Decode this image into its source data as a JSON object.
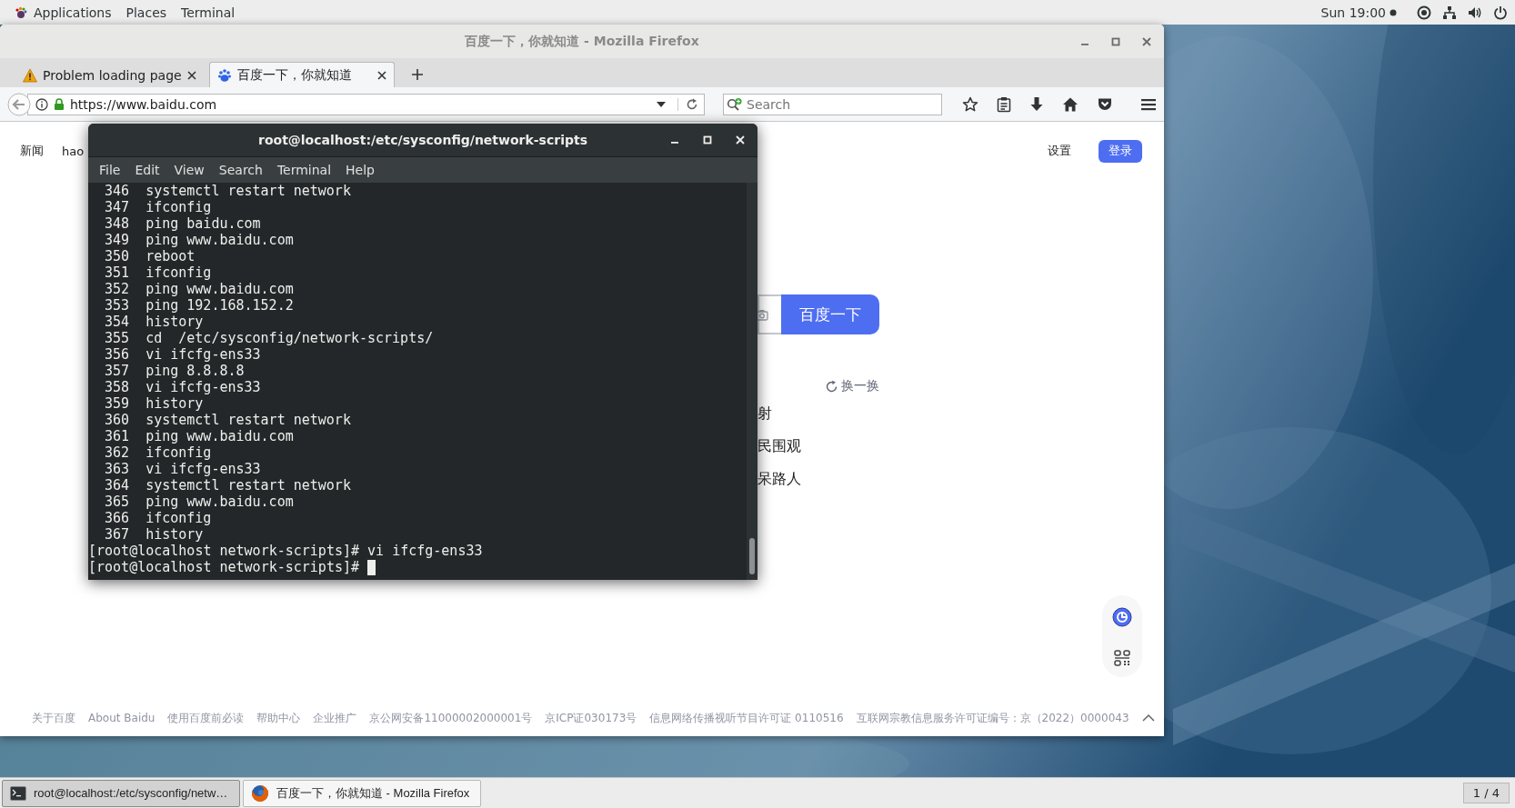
{
  "top_bar": {
    "applications": "Applications",
    "menus": [
      "Places",
      "Terminal"
    ],
    "clock": "Sun 19:00"
  },
  "firefox": {
    "title": "百度一下，你就知道 - Mozilla Firefox",
    "tabs": [
      {
        "label": "Problem loading page",
        "kind": "warning",
        "selected": false
      },
      {
        "label": "百度一下，你就知道",
        "kind": "baidu",
        "selected": true
      }
    ],
    "url": "https://www.baidu.com",
    "search_placeholder": "Search",
    "page": {
      "nav_links": [
        "新闻",
        "hao"
      ],
      "settings": "设置",
      "login": "登录",
      "search_button": "百度一下",
      "refresh": "换一换",
      "hot_items": [
        "射",
        "民围观",
        "呆路人"
      ],
      "footer_links": [
        "关于百度",
        "About Baidu",
        "使用百度前必读",
        "帮助中心",
        "企业推广",
        "京公网安备11000002000001号",
        "京ICP证030173号",
        "信息网络传播视听节目许可证 0110516",
        "互联网宗教信息服务许可证编号：京（2022）0000043"
      ]
    }
  },
  "terminal": {
    "title": "root@localhost:/etc/sysconfig/network-scripts",
    "menus": [
      "File",
      "Edit",
      "View",
      "Search",
      "Terminal",
      "Help"
    ],
    "history": [
      {
        "number": "346",
        "command": "systemctl restart network"
      },
      {
        "number": "347",
        "command": "ifconfig"
      },
      {
        "number": "348",
        "command": "ping baidu.com"
      },
      {
        "number": "349",
        "command": "ping www.baidu.com"
      },
      {
        "number": "350",
        "command": "reboot"
      },
      {
        "number": "351",
        "command": "ifconfig"
      },
      {
        "number": "352",
        "command": "ping www.baidu.com"
      },
      {
        "number": "353",
        "command": "ping 192.168.152.2"
      },
      {
        "number": "354",
        "command": "history"
      },
      {
        "number": "355",
        "command": "cd  /etc/sysconfig/network-scripts/"
      },
      {
        "number": "356",
        "command": "vi ifcfg-ens33"
      },
      {
        "number": "357",
        "command": "ping 8.8.8.8"
      },
      {
        "number": "358",
        "command": "vi ifcfg-ens33"
      },
      {
        "number": "359",
        "command": "history"
      },
      {
        "number": "360",
        "command": "systemctl restart network"
      },
      {
        "number": "361",
        "command": "ping www.baidu.com"
      },
      {
        "number": "362",
        "command": "ifconfig"
      },
      {
        "number": "363",
        "command": "vi ifcfg-ens33"
      },
      {
        "number": "364",
        "command": "systemctl restart network"
      },
      {
        "number": "365",
        "command": "ping www.baidu.com"
      },
      {
        "number": "366",
        "command": "ifconfig"
      },
      {
        "number": "367",
        "command": "history"
      }
    ],
    "prompts": [
      {
        "prompt": "[root@localhost network-scripts]#",
        "command": "vi ifcfg-ens33",
        "cursor": false
      },
      {
        "prompt": "[root@localhost network-scripts]#",
        "cursor": true
      }
    ]
  },
  "taskbar": {
    "items": [
      {
        "label": "root@localhost:/etc/sysconfig/netw…",
        "kind": "terminal",
        "selected": true
      },
      {
        "label": "百度一下，你就知道 - Mozilla Firefox",
        "kind": "firefox",
        "selected": false
      }
    ],
    "workspace": "1 / 4"
  }
}
